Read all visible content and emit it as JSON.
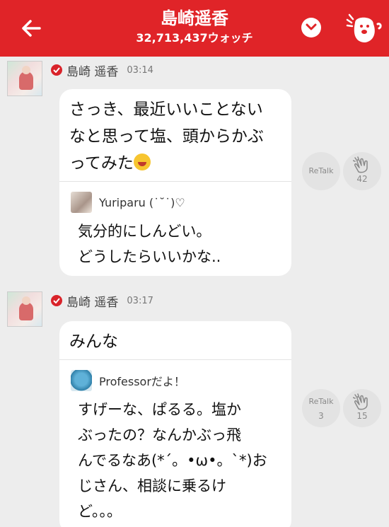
{
  "header": {
    "title": "島崎遥香",
    "watch_count": "32,713,437ウォッチ"
  },
  "messages": [
    {
      "sender": "島崎 遥香",
      "time": "03:14",
      "text_lines": [
        "さっき、最近いいことない",
        "なと思って塩、頭からかぶ",
        "ってみた"
      ],
      "reply": {
        "name": "Yuriparu (˙˘˙)♡",
        "lines": [
          "気分的にしんどい。",
          "どうしたらいいかな.."
        ]
      },
      "retalk": {
        "label": "ReTalk",
        "count": ""
      },
      "clap": {
        "count": "42"
      }
    },
    {
      "sender": "島崎 遥香",
      "time": "03:17",
      "text_lines": [
        "みんな"
      ],
      "reply": {
        "name": "Professorだよ！",
        "lines": [
          "すげーな、ぱるる。塩か",
          "ぶったの？なんかぶっ飛",
          "んでるなあ(*´。•ω•。`*)お",
          "じさん、相談に乗るけ",
          "ど。。。"
        ]
      },
      "retalk": {
        "label": "ReTalk",
        "count": "3"
      },
      "clap": {
        "count": "15"
      }
    }
  ],
  "colors": {
    "header_bg": "#e02428",
    "bubble_bg": "#ffffff",
    "page_bg": "#ededed",
    "verified": "#d9232a"
  },
  "icons": [
    "back-arrow-icon",
    "chevron-down-icon",
    "clap-ghost-icon",
    "verified-check-icon",
    "laughing-emoji-icon",
    "clap-hands-icon"
  ]
}
